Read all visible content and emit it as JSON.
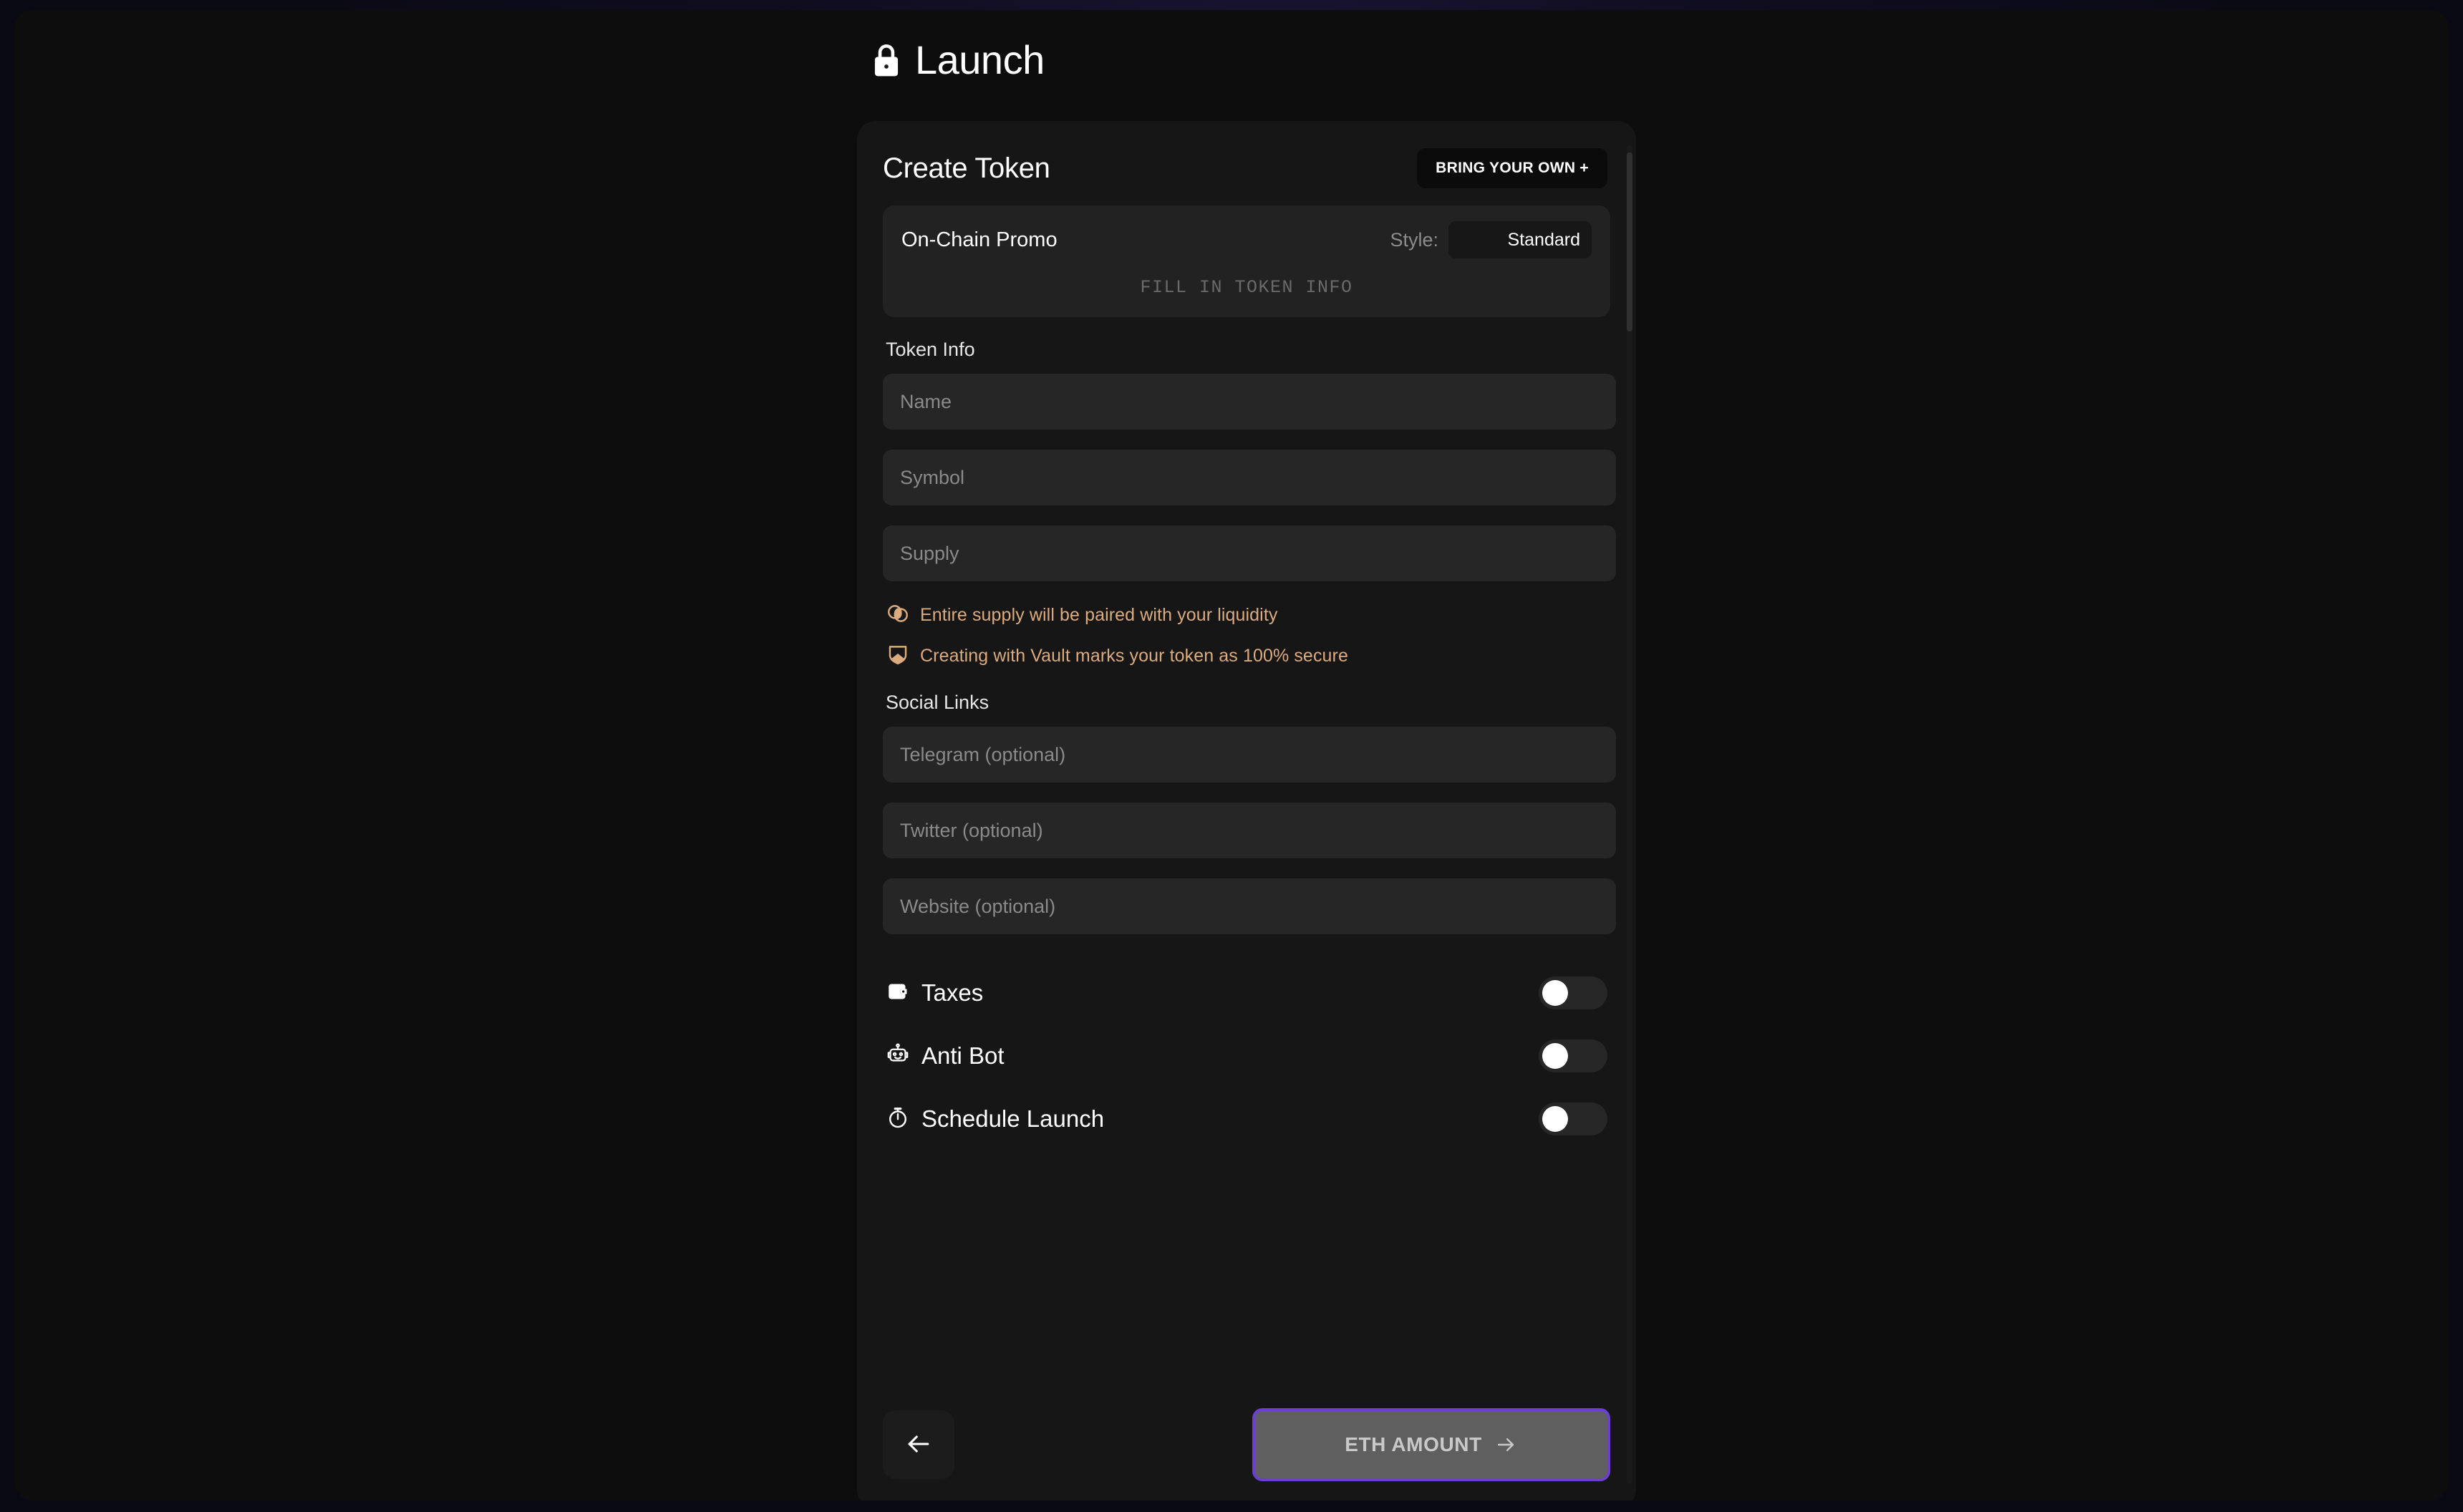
{
  "header": {
    "title": "Launch",
    "icon": "lock-icon"
  },
  "card": {
    "title": "Create Token",
    "bring_your_own_label": "BRING YOUR OWN +",
    "promo": {
      "label": "On-Chain Promo",
      "style_label": "Style:",
      "style_value": "Standard",
      "style_options": [
        "Standard"
      ],
      "placeholder_text": "FILL IN TOKEN INFO"
    },
    "token_info": {
      "heading": "Token Info",
      "fields": [
        {
          "name": "name",
          "placeholder": "Name",
          "value": ""
        },
        {
          "name": "symbol",
          "placeholder": "Symbol",
          "value": ""
        },
        {
          "name": "supply",
          "placeholder": "Supply",
          "value": ""
        }
      ]
    },
    "notices": [
      {
        "icon": "liquidity-drops-icon",
        "text": "Entire supply will be paired with your liquidity"
      },
      {
        "icon": "shield-icon",
        "text": "Creating with Vault marks your token as 100% secure"
      }
    ],
    "social_links": {
      "heading": "Social Links",
      "fields": [
        {
          "name": "telegram",
          "placeholder": "Telegram (optional)",
          "value": ""
        },
        {
          "name": "twitter",
          "placeholder": "Twitter (optional)",
          "value": ""
        },
        {
          "name": "website",
          "placeholder": "Website (optional)",
          "value": ""
        }
      ]
    },
    "toggles": [
      {
        "name": "taxes",
        "icon": "wallet-icon",
        "label": "Taxes",
        "enabled": false
      },
      {
        "name": "anti-bot",
        "icon": "robot-icon",
        "label": "Anti Bot",
        "enabled": false
      },
      {
        "name": "schedule-launch",
        "icon": "stopwatch-icon",
        "label": "Schedule Launch",
        "enabled": false
      }
    ],
    "footer": {
      "back_icon": "arrow-left-icon",
      "submit_label": "ETH AMOUNT",
      "submit_icon": "arrow-right-icon",
      "submit_disabled": true
    }
  },
  "colors": {
    "accent_purple": "#6d3fd0",
    "notice_amber": "#dbab7e",
    "card_background": "#161616",
    "field_background": "#262626",
    "page_background": "#0d0d0d"
  }
}
